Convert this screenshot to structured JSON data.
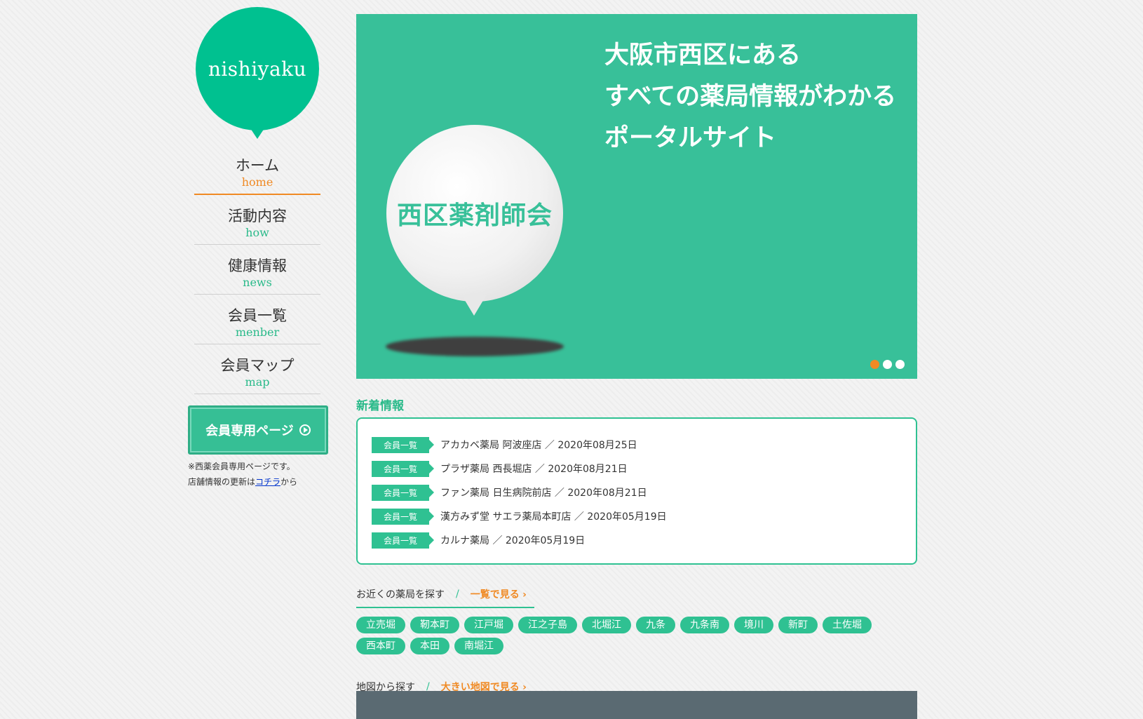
{
  "logo": {
    "text": "nishiyaku"
  },
  "nav": [
    {
      "ja": "ホーム",
      "en": "home"
    },
    {
      "ja": "活動内容",
      "en": "how"
    },
    {
      "ja": "健康情報",
      "en": "news"
    },
    {
      "ja": "会員一覧",
      "en": "menber"
    },
    {
      "ja": "会員マップ",
      "en": "map"
    }
  ],
  "member_button": {
    "label": "会員専用ページ"
  },
  "note": {
    "line1": "※西薬会員専用ページです。",
    "line2_before": "店舗情報の更新は",
    "line2_link": "コチラ",
    "line2_after": "から"
  },
  "hero": {
    "ball_text": "西区薬剤師会",
    "line1": "大阪市西区にある",
    "line2": "すべての薬局情報がわかる",
    "line3": "ポータルサイト"
  },
  "news": {
    "title": "新着情報",
    "items": [
      {
        "tag": "会員一覧",
        "text": "アカカベ薬局 阿波座店 ／ 2020年08月25日"
      },
      {
        "tag": "会員一覧",
        "text": "プラザ薬局 西長堀店 ／ 2020年08月21日"
      },
      {
        "tag": "会員一覧",
        "text": "ファン薬局 日生病院前店 ／ 2020年08月21日"
      },
      {
        "tag": "会員一覧",
        "text": "漢方みず堂 サエラ薬局本町店 ／ 2020年05月19日"
      },
      {
        "tag": "会員一覧",
        "text": "カルナ薬局 ／ 2020年05月19日"
      }
    ]
  },
  "nearby": {
    "title": "お近くの薬局を探す",
    "link": "一覧で見る",
    "areas": [
      "立売堀",
      "靭本町",
      "江戸堀",
      "江之子島",
      "北堀江",
      "九条",
      "九条南",
      "境川",
      "新町",
      "土佐堀",
      "西本町",
      "本田",
      "南堀江"
    ]
  },
  "map_section": {
    "title": "地図から探す",
    "link": "大きい地図で見る"
  },
  "colors": {
    "accent": "#2fc192",
    "orange": "#f08a24",
    "logo": "#00c190"
  }
}
